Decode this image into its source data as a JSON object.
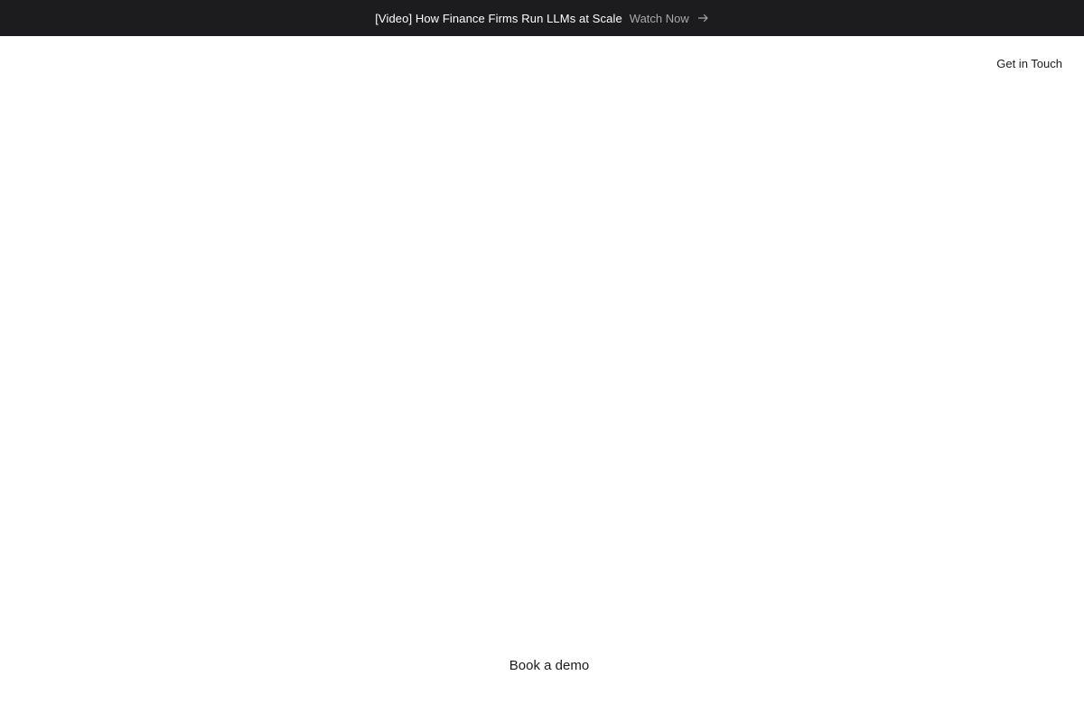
{
  "announcement": {
    "text": "[Video] How Finance Firms Run LLMs at Scale",
    "link_label": "Watch Now",
    "link_icon": "arrow-right-icon"
  },
  "header": {
    "contact_label": "Get in Touch"
  },
  "hero": {
    "cta_label": "Book a demo"
  },
  "colors": {
    "announcement_bg": "#1c1c1e",
    "announcement_text": "#ffffff",
    "announcement_link": "#a8a8a8",
    "page_bg": "#ffffff",
    "text_dark": "#1a1a1a"
  }
}
